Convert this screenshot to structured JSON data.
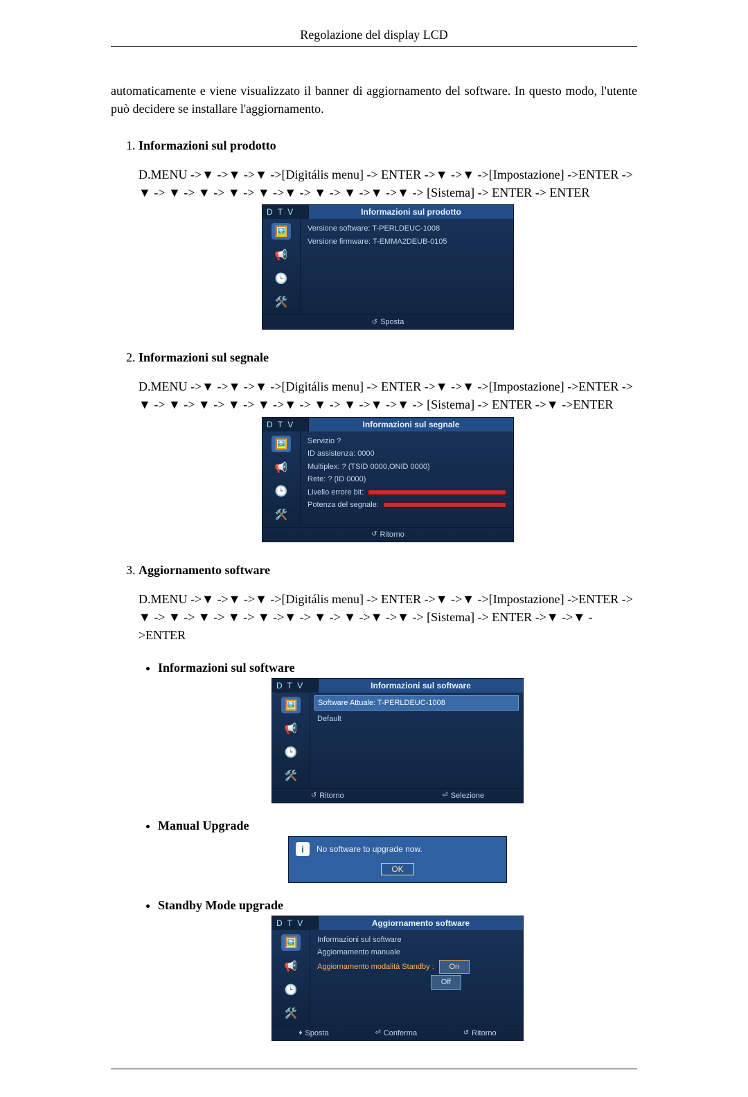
{
  "header": {
    "title": "Regolazione del display LCD"
  },
  "intro": "automaticamente e viene visualizzato il banner di aggiornamento del software. In questo modo, l'utente può decidere se installare l'aggiornamento.",
  "items": [
    {
      "title": "Informazioni sul prodotto",
      "nav": "D.MENU ->▼ ->▼ ->▼ ->[Digitális menu] -> ENTER ->▼ ->▼ ->[Impostazione] ->ENTER -> ▼ -> ▼ -> ▼ -> ▼ -> ▼ ->▼ -> ▼ -> ▼ ->▼ ->▼ -> [Sistema] -> ENTER -> ENTER",
      "osd": {
        "tab": "D T V",
        "title": "Informazioni sul prodotto",
        "lines": [
          "Versione software: T-PERLDEUC-1008",
          "Versione firmware: T-EMMA2DEUB-0105"
        ],
        "footer": [
          {
            "sym": "↺",
            "label": "Sposta"
          }
        ]
      }
    },
    {
      "title": "Informazioni sul segnale",
      "nav": "D.MENU ->▼ ->▼ ->▼ ->[Digitális menu] -> ENTER ->▼ ->▼ ->[Impostazione] ->ENTER -> ▼ -> ▼ -> ▼ -> ▼ -> ▼ ->▼ -> ▼ -> ▼ ->▼ ->▼ -> [Sistema] -> ENTER ->▼ ->ENTER",
      "osd": {
        "tab": "D T V",
        "title": "Informazioni sul segnale",
        "lines": [
          "Servizio ?",
          "ID assistenza: 0000",
          "Multiplex: ? (TSID 0000,ONID 0000)",
          "Rete: ? (ID 0000)"
        ],
        "bar_rows": [
          {
            "label": "Livello errore bit:"
          },
          {
            "label": "Potenza del segnale:"
          }
        ],
        "footer": [
          {
            "sym": "↺",
            "label": "Ritorno"
          }
        ]
      }
    },
    {
      "title": "Aggiornamento software",
      "nav": "D.MENU ->▼ ->▼ ->▼ ->[Digitális menu] -> ENTER ->▼ ->▼ ->[Impostazione] ->ENTER -> ▼ -> ▼ -> ▼ -> ▼ -> ▼ ->▼ -> ▼ -> ▼ ->▼ ->▼ -> [Sistema] -> ENTER ->▼ ->▼ ->ENTER",
      "sub": [
        {
          "title": "Informazioni sul software",
          "osd": {
            "tab": "D T V",
            "title": "Informazioni sul software",
            "highlight": "Software Attuale: T-PERLDEUC-1008",
            "extra": "Default",
            "footer": [
              {
                "sym": "↺",
                "label": "Ritorno"
              },
              {
                "sym": "⏎",
                "label": "Selezione"
              }
            ]
          }
        },
        {
          "title": "Manual Upgrade",
          "dialog": {
            "msg": "No software to upgrade now.",
            "ok": "OK"
          }
        },
        {
          "title": "Standby Mode upgrade",
          "osd": {
            "tab": "D T V",
            "title": "Aggiornamento software",
            "menu": [
              {
                "label": "Informazioni sul software",
                "selected": false
              },
              {
                "label": "Aggiornamento manuale",
                "selected": false
              },
              {
                "label": "Aggiornamento modalità Standby :",
                "selected": true,
                "pill_on": "On",
                "pill_off": "Off"
              }
            ],
            "footer": [
              {
                "sym": "♦",
                "label": "Sposta"
              },
              {
                "sym": "⏎",
                "label": "Conferma"
              },
              {
                "sym": "↺",
                "label": "Ritorno"
              }
            ]
          }
        }
      ]
    }
  ]
}
